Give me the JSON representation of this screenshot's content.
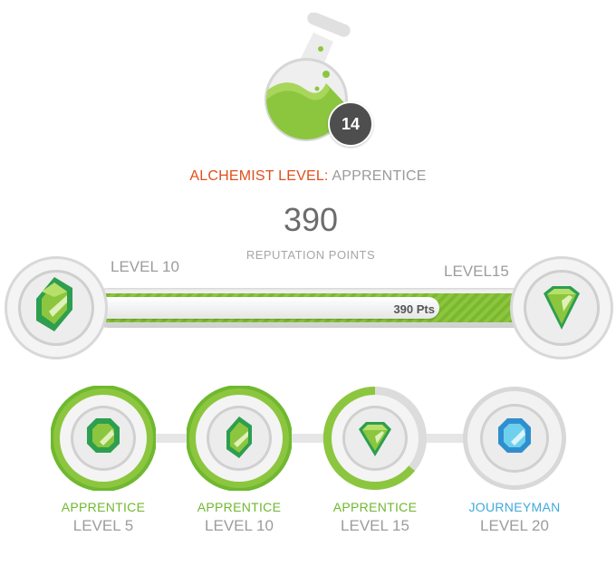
{
  "header": {
    "badge_number": "14",
    "title_label": "ALCHEMIST LEVEL:",
    "title_value": "APPRENTICE"
  },
  "points": {
    "value": "390",
    "caption": "REPUTATION POINTS"
  },
  "progress": {
    "left_level": "LEVEL 10",
    "right_level": "LEVEL15",
    "points_label": "390 Pts",
    "fill_fraction": 0.8
  },
  "milestones": [
    {
      "rank": "APPRENTICE",
      "level": "LEVEL 5",
      "gem": "octagon-gem"
    },
    {
      "rank": "APPRENTICE",
      "level": "LEVEL 10",
      "gem": "hexagon-gem"
    },
    {
      "rank": "APPRENTICE",
      "level": "LEVEL 15",
      "gem": "diamond-gem"
    },
    {
      "rank": "JOURNEYMAN",
      "level": "LEVEL 20",
      "gem": "octagon-gem"
    }
  ],
  "colors": {
    "accent_orange": "#e04f1d",
    "green": "#8cc63f",
    "dark_green": "#2e9e4f",
    "blue": "#3fa9dd",
    "gray_text": "#9c9c9c"
  }
}
